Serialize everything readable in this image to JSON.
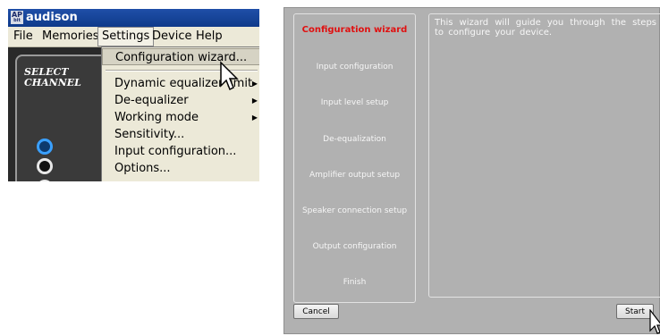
{
  "app": {
    "logo_top": "AP",
    "logo_bottom": "bit",
    "title": "audison"
  },
  "menubar": {
    "items": [
      "File",
      "Memories",
      "Settings",
      "Device",
      "Help"
    ]
  },
  "panel": {
    "select_channel": "SELECT\nCHANNEL"
  },
  "settings_menu": {
    "items": [
      {
        "label": "Configuration wizard...",
        "submenu": false
      },
      {
        "label": "Dynamic equalizer limit",
        "submenu": true
      },
      {
        "label": "De-equalizer",
        "submenu": true
      },
      {
        "label": "Working mode",
        "submenu": true
      },
      {
        "label": "Sensitivity...",
        "submenu": false
      },
      {
        "label": "Input configuration...",
        "submenu": false
      },
      {
        "label": "Options...",
        "submenu": false
      }
    ]
  },
  "wizard": {
    "steps": [
      "Configuration wizard",
      "Input configuration",
      "Input level setup",
      "De-equalization",
      "Amplifier output setup",
      "Speaker connection setup",
      "Output configuration",
      "Finish"
    ],
    "current_step": 0,
    "message": "This wizard will guide you through the steps to configure your device.",
    "cancel_label": "Cancel",
    "start_label": "Start"
  },
  "colors": {
    "current_step": "#e01010",
    "wizard_bg": "#b1b1b1",
    "menu_bg": "#ece9d8",
    "titlebar": "#0f3a8a"
  }
}
